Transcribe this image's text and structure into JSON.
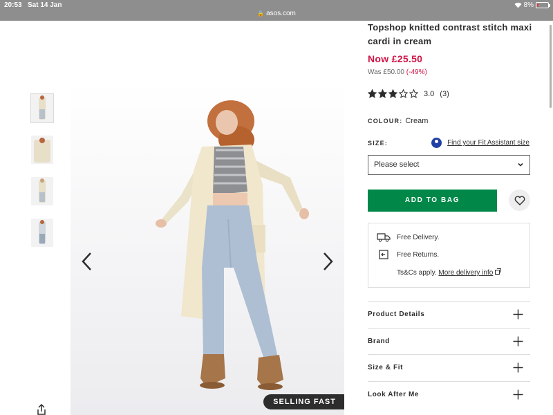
{
  "status_bar": {
    "time": "20:53",
    "date": "Sat 14 Jan",
    "url": "asos.com",
    "battery": "8%",
    "battery_level": 0.08,
    "battery_color": "#e23b3b"
  },
  "product": {
    "title": "Topshop knitted contrast stitch maxi cardi in cream",
    "now_price": "Now £25.50",
    "was_price": "Was £50.00",
    "discount": "(-49%)",
    "price_color": "#d01345",
    "rating_stars": 3,
    "rating_max": 5,
    "rating_score": "3.0",
    "rating_count": "(3)",
    "colour_label": "COLOUR:",
    "colour_value": "Cream",
    "size_label": "SIZE:",
    "fit_assistant_link": "Find your Fit Assistant size",
    "size_select_placeholder": "Please select",
    "add_to_bag": "ADD TO BAG",
    "add_to_bag_color": "#018849",
    "badge": "SELLING FAST"
  },
  "delivery": {
    "free_delivery": "Free Delivery.",
    "free_returns": "Free Returns.",
    "tcs_text": "Ts&Cs apply.",
    "more_info_link": "More delivery info"
  },
  "accordion": [
    {
      "label": "Product Details"
    },
    {
      "label": "Brand"
    },
    {
      "label": "Size & Fit"
    },
    {
      "label": "Look After Me"
    }
  ],
  "icons": {
    "share": "share-icon",
    "prev": "chevron-left-icon",
    "next": "chevron-right-icon",
    "heart": "heart-icon",
    "truck": "truck-icon",
    "returns": "returns-icon",
    "external": "external-link-icon",
    "plus": "plus-icon"
  }
}
